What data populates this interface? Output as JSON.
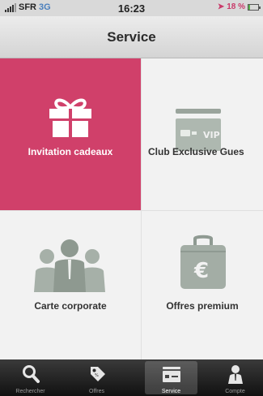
{
  "status_bar": {
    "carrier": "SFR",
    "network": "3G",
    "time": "16:23",
    "battery_percent": "18 %",
    "battery_level": 0.18
  },
  "nav": {
    "title": "Service"
  },
  "tiles": [
    {
      "label": "Invitation cadeaux",
      "icon": "gift-icon",
      "active": true
    },
    {
      "label": "Club Exclusive Gues",
      "icon": "vip-card-icon",
      "active": false
    },
    {
      "label": "Carte corporate",
      "icon": "people-group-icon",
      "active": false
    },
    {
      "label": "Offres premium",
      "icon": "euro-suitcase-icon",
      "active": false
    }
  ],
  "tabs": [
    {
      "label": "Rechercher",
      "icon": "search-icon",
      "selected": false
    },
    {
      "label": "Offres",
      "icon": "tag-icon",
      "selected": false
    },
    {
      "label": "Service",
      "icon": "card-icon",
      "selected": true
    },
    {
      "label": "Compte",
      "icon": "person-icon",
      "selected": false
    }
  ],
  "colors": {
    "accent": "#d0406a",
    "tile_bg": "#f2f2f2",
    "tab_bar": "#1f1f1f"
  }
}
